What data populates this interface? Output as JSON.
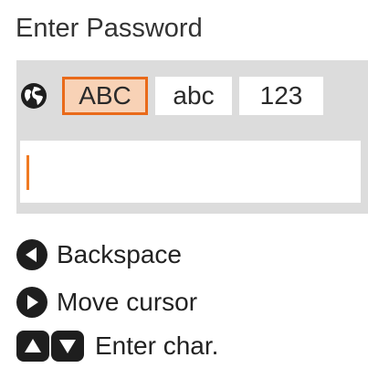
{
  "header": {
    "title": "Enter Password"
  },
  "input_mode": {
    "language_icon": "globe-icon",
    "modes": [
      {
        "label": "ABC",
        "selected": true
      },
      {
        "label": "abc",
        "selected": false
      },
      {
        "label": "123",
        "selected": false
      }
    ]
  },
  "password_field": {
    "value": ""
  },
  "help": {
    "backspace": {
      "icon": "left-arrow-button-icon",
      "label": "Backspace"
    },
    "move_cursor": {
      "icon": "right-arrow-button-icon",
      "label": "Move cursor"
    },
    "enter_char": {
      "icons": [
        "up-arrow-button-icon",
        "down-arrow-button-icon"
      ],
      "label": "Enter char."
    }
  },
  "colors": {
    "accent": "#e96a1a",
    "selected_fill": "#f8d2b6",
    "panel_bg": "#dcdcdc",
    "cursor": "#f07a22"
  }
}
